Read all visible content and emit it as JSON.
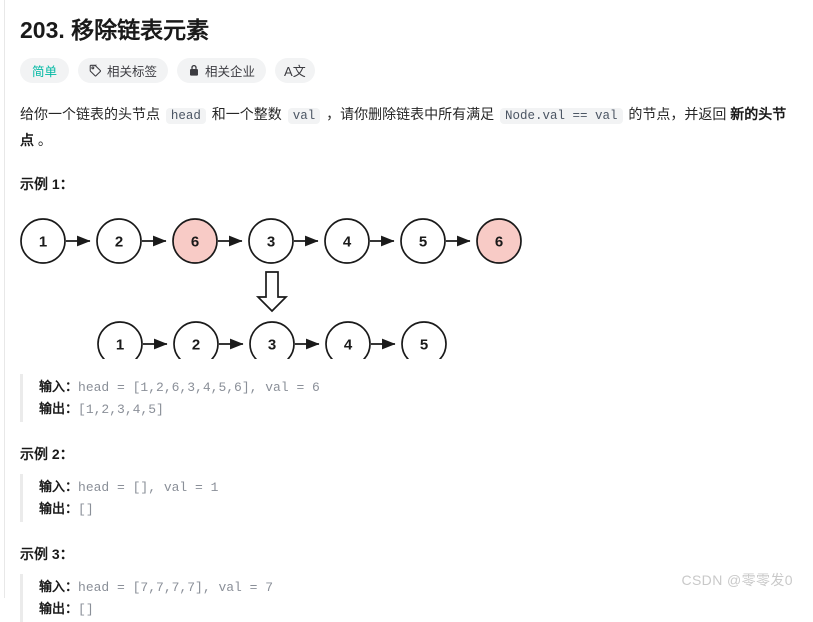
{
  "problem": {
    "number": "203.",
    "title": "203. 移除链表元素",
    "difficulty": "简单",
    "tags_label": "相关标签",
    "companies_label": "相关企业",
    "font_toggle_label": "A文"
  },
  "icons": {
    "tag": "tag-icon",
    "lock": "lock-icon",
    "font": "font-toggle-icon"
  },
  "description": {
    "part1": "给你一个链表的头节点 ",
    "code1": "head",
    "part2": " 和一个整数 ",
    "code2": "val",
    "part3": " ，请你删除链表中所有满足 ",
    "code3": "Node.val == val",
    "part4": " 的节点，并返回 ",
    "bold1": "新的头节点",
    "part5": " 。"
  },
  "examples": [
    {
      "heading": "示例 1：",
      "input_label": "输入：",
      "input_value": "head = [1,2,6,3,4,5,6], val = 6",
      "output_label": "输出：",
      "output_value": "[1,2,3,4,5]"
    },
    {
      "heading": "示例 2：",
      "input_label": "输入：",
      "input_value": "head = [], val = 1",
      "output_label": "输出：",
      "output_value": "[]"
    },
    {
      "heading": "示例 3：",
      "input_label": "输入：",
      "input_value": "head = [7,7,7,7], val = 7",
      "output_label": "输出：",
      "output_value": "[]"
    }
  ],
  "diagram": {
    "before_list": [
      "1",
      "2",
      "6",
      "3",
      "4",
      "5",
      "6"
    ],
    "before_highlighted": [
      2,
      6
    ],
    "after_list": [
      "1",
      "2",
      "3",
      "4",
      "5"
    ],
    "highlight_color": "#f8cbc6",
    "node_stroke": "#1a1a1a",
    "node_fill": "#ffffff",
    "arrow_color": "#1a1a1a"
  },
  "watermark": "CSDN @零零发0"
}
